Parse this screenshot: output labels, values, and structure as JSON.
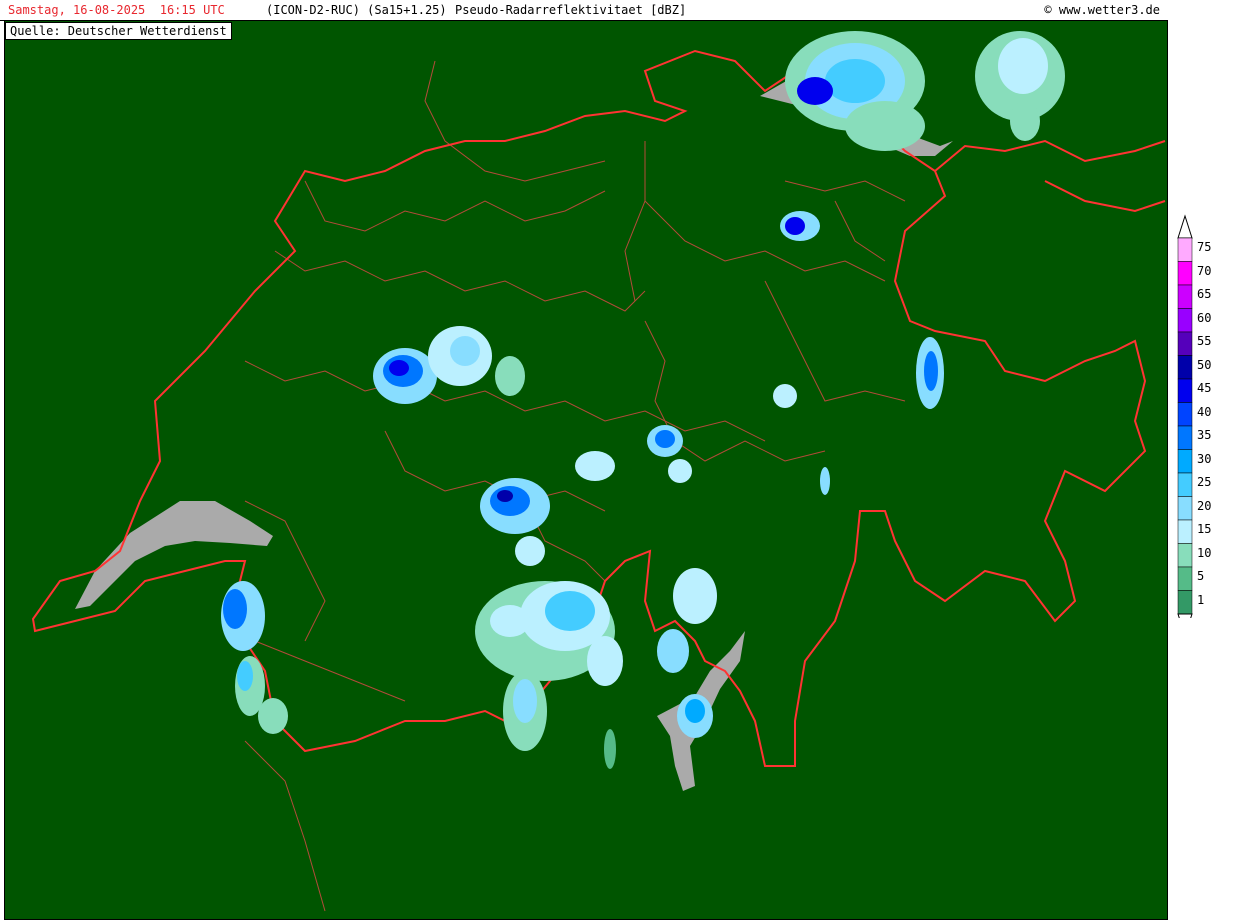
{
  "header": {
    "datetime": "Samstag, 16-08-2025  16:15 UTC",
    "model": "(ICON-D2-RUC) (Sa15+1.25)",
    "product": "Pseudo-Radarreflektivitaet [dBZ]",
    "credit": "© www.wetter3.de"
  },
  "source": "Quelle: Deutscher Wetterdienst",
  "colors": {
    "background": "#005500",
    "border": "#ff3333",
    "lake": "#aaaaaa"
  },
  "legend": {
    "unit": "dBZ",
    "levels": [
      {
        "label": "75",
        "color": "#ffaaff"
      },
      {
        "label": "70",
        "color": "#ff00ff"
      },
      {
        "label": "65",
        "color": "#cc00ff"
      },
      {
        "label": "60",
        "color": "#9900ff"
      },
      {
        "label": "55",
        "color": "#5500bb"
      },
      {
        "label": "50",
        "color": "#0000aa"
      },
      {
        "label": "45",
        "color": "#0000ee"
      },
      {
        "label": "40",
        "color": "#0044ff"
      },
      {
        "label": "35",
        "color": "#0077ff"
      },
      {
        "label": "30",
        "color": "#00aaff"
      },
      {
        "label": "25",
        "color": "#44ccff"
      },
      {
        "label": "20",
        "color": "#88ddff"
      },
      {
        "label": "15",
        "color": "#bbf0ff"
      },
      {
        "label": "10",
        "color": "#88ddbb"
      },
      {
        "label": "5",
        "color": "#55bb88"
      },
      {
        "label": "1",
        "color": "#339966"
      }
    ]
  }
}
